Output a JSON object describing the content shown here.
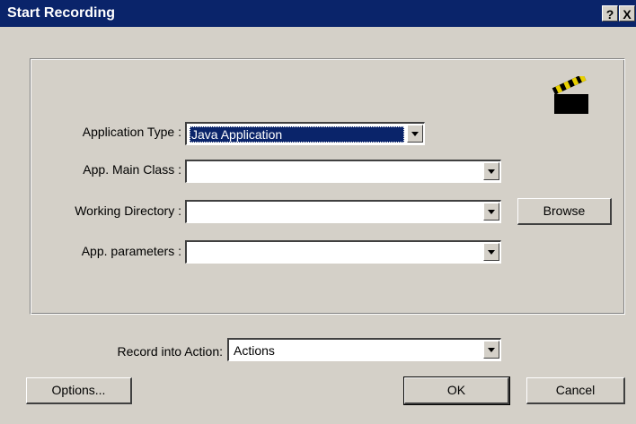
{
  "window": {
    "title": "Start Recording",
    "help_label": "?",
    "close_label": "X"
  },
  "icons": {
    "recording": "clapperboard-icon"
  },
  "fields": {
    "application_type": {
      "label": "Application Type :",
      "value": "Java Application"
    },
    "main_class": {
      "label": "App. Main Class :",
      "value": ""
    },
    "working_directory": {
      "label": "Working Directory :",
      "value": ""
    },
    "parameters": {
      "label": "App. parameters :",
      "value": ""
    },
    "record_into_action": {
      "label": "Record into Action:",
      "value": "Actions"
    }
  },
  "buttons": {
    "browse": "Browse",
    "options": "Options...",
    "ok": "OK",
    "cancel": "Cancel"
  }
}
